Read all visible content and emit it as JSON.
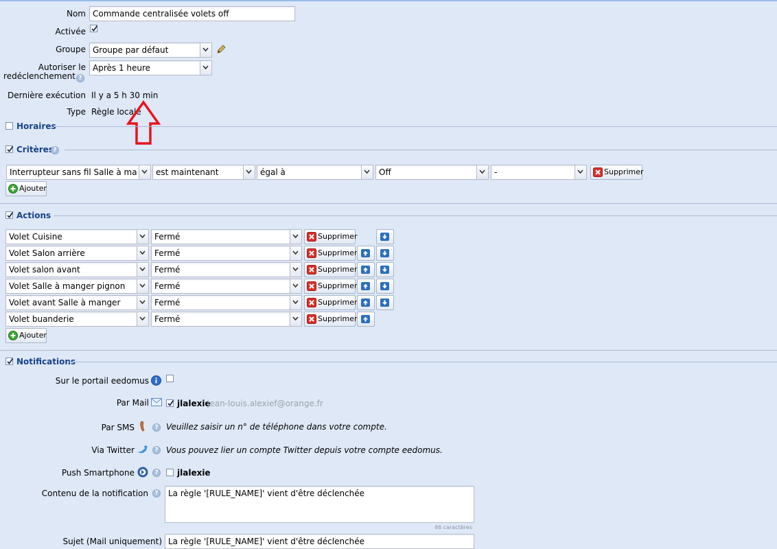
{
  "general": {
    "nom_label": "Nom",
    "nom_value": "Commande centralisée volets off",
    "activee_label": "Activée",
    "activee_checked": true,
    "groupe_label": "Groupe",
    "groupe_value": "Groupe par défaut",
    "autoriser_label_1": "Autoriser le",
    "autoriser_label_2": "redéclenchement",
    "autoriser_value": "Après 1 heure",
    "derniere_label": "Dernière exécution",
    "derniere_value": "Il y a 5 h 30 min",
    "type_label": "Type",
    "type_value": "Règle locale"
  },
  "sections": {
    "horaires": {
      "title": "Horaires",
      "checked": false
    },
    "criteres": {
      "title": "Critères",
      "checked": true
    },
    "actions": {
      "title": "Actions",
      "checked": true
    },
    "notifications": {
      "title": "Notifications",
      "checked": true
    }
  },
  "critere": {
    "device": "Interrupteur sans fil Salle à manger",
    "when": "est maintenant",
    "operator": "égal à",
    "value": "Off",
    "extra": "-",
    "delete_label": "Supprimer"
  },
  "ajouter_label": "Ajouter",
  "actions": [
    {
      "device": "Volet Cuisine",
      "state": "Fermé",
      "delete_label": "Supprimer",
      "up": false,
      "down": true
    },
    {
      "device": "Volet Salon arrière",
      "state": "Fermé",
      "delete_label": "Supprimer",
      "up": true,
      "down": true
    },
    {
      "device": "Volet salon avant",
      "state": "Fermé",
      "delete_label": "Supprimer",
      "up": true,
      "down": true
    },
    {
      "device": "Volet Salle à manger pignon",
      "state": "Fermé",
      "delete_label": "Supprimer",
      "up": true,
      "down": true
    },
    {
      "device": "Volet avant Salle à manger",
      "state": "Fermé",
      "delete_label": "Supprimer",
      "up": true,
      "down": true
    },
    {
      "device": "Volet buanderie",
      "state": "Fermé",
      "delete_label": "Supprimer",
      "up": true,
      "down": false
    }
  ],
  "notifications": {
    "portail_label": "Sur le portail eedomus",
    "portail_checked": false,
    "mail_label": "Par Mail",
    "mail_user": "jlalexie",
    "mail_address": "jean-louis.alexief@orange.fr",
    "mail_checked": true,
    "sms_label": "Par SMS",
    "sms_text": "Veuillez saisir un n° de téléphone dans votre compte.",
    "twitter_label": "Via Twitter",
    "twitter_text": "Vous pouvez lier un compte Twitter depuis votre compte eedomus.",
    "push_label": "Push Smartphone",
    "push_user": "jlalexie",
    "push_checked": false,
    "contenu_label": "Contenu de la notification",
    "contenu_value": "La règle '[RULE_NAME]' vient d'être déclenchée",
    "counter": "46 caractères",
    "sujet_label": "Sujet (Mail uniquement)",
    "sujet_value": "La règle '[RULE_NAME]' vient d'être déclenchée"
  },
  "colors": {
    "background": "#dfe8f6",
    "section_title": "#15428b",
    "annotation_arrow": "#e8141c"
  }
}
